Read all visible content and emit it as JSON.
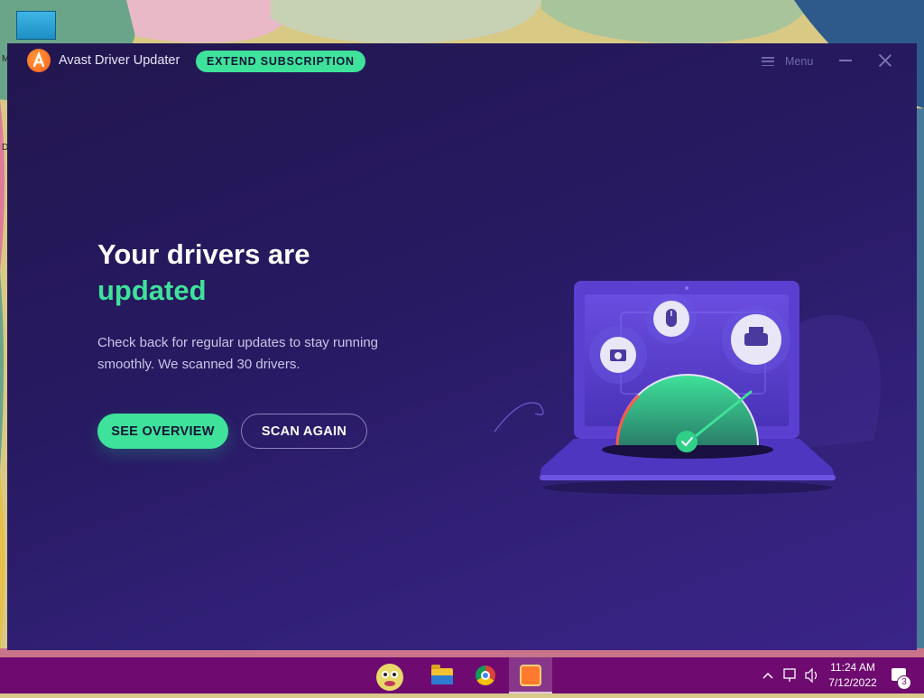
{
  "colors": {
    "accent_green": "#3ee29a",
    "window_bg": "#281a63",
    "taskbar": "#6e0a70",
    "logo_orange": "#ff6a1f"
  },
  "desktop": {
    "icon": "monitor-icon",
    "edge_letters": [
      "M",
      "D"
    ]
  },
  "window": {
    "app_title": "Avast Driver Updater",
    "logo_icon": "avast-logo-icon",
    "extend_label": "EXTEND SUBSCRIPTION",
    "menu_label": "Menu",
    "menu_icon": "hamburger-icon",
    "minimize_icon": "minimize-icon",
    "close_icon": "close-icon"
  },
  "main": {
    "headline": "Your drivers are",
    "headline_accent": "updated",
    "subtext": "Check back for regular updates to stay running smoothly. We scanned 30 drivers.",
    "overview_label": "SEE OVERVIEW",
    "scan_label": "SCAN AGAIN"
  },
  "illustration": {
    "icons": [
      "camera-icon",
      "mouse-icon",
      "printer-icon",
      "checkmark-icon"
    ]
  },
  "taskbar": {
    "apps": [
      "cartoon-app-icon",
      "file-explorer-icon",
      "chrome-icon",
      "avast-icon"
    ],
    "tray_icons": [
      "chevron-up-icon",
      "network-icon",
      "volume-icon"
    ],
    "time": "11:24 AM",
    "date": "7/12/2022",
    "notification_count": "3"
  }
}
